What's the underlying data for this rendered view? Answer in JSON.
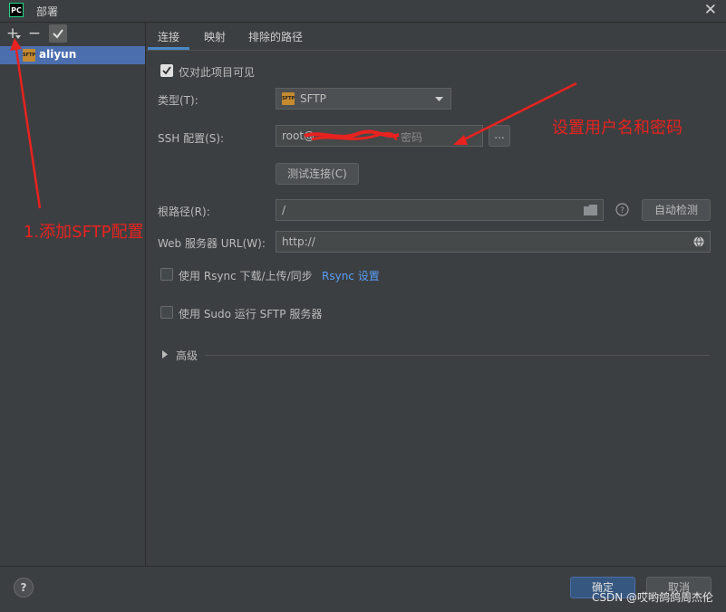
{
  "window": {
    "app_icon": "PC",
    "title": "部署",
    "close_symbol": "✕"
  },
  "toolbar": {
    "add_symbol": "+",
    "remove_symbol": "−"
  },
  "tree": {
    "items": [
      {
        "label": "aliyun",
        "icon_text": "SFTP"
      }
    ]
  },
  "tabs": [
    {
      "label": "连接"
    },
    {
      "label": "映射"
    },
    {
      "label": "排除的路径"
    }
  ],
  "form": {
    "visible_only_project": {
      "label": "仅对此项目可见",
      "checked": true
    },
    "type": {
      "label": "类型(T):",
      "value": "SFTP"
    },
    "ssh": {
      "label": "SSH 配置(S):",
      "value_prefix": "root@",
      "value_suffix": "密码",
      "browse_label": "..."
    },
    "test_button": "测试连接(C)",
    "root_path": {
      "label": "根路径(R):",
      "value": "/"
    },
    "autodetect_button": "自动检测",
    "web_url": {
      "label": "Web 服务器 URL(W):",
      "value": "http://"
    },
    "rsync": {
      "label": "使用 Rsync 下载/上传/同步",
      "checked": false,
      "link": "Rsync 设置"
    },
    "sudo": {
      "label": "使用 Sudo 运行 SFTP 服务器",
      "checked": false
    },
    "advanced": "高级"
  },
  "footer": {
    "help": "?",
    "ok": "确定",
    "cancel": "取消"
  },
  "annotations": {
    "add_sftp": "1.添加SFTP配置",
    "set_credentials": "设置用户名和密码"
  },
  "watermark": "CSDN @哎哟鸽鸽周杰伦",
  "colors": {
    "background": "#3c3f41",
    "field": "#45494a",
    "accent": "#4a88c7",
    "selection": "#4b6eaf",
    "annotation": "#e8221f",
    "ok_button": "#365880"
  }
}
